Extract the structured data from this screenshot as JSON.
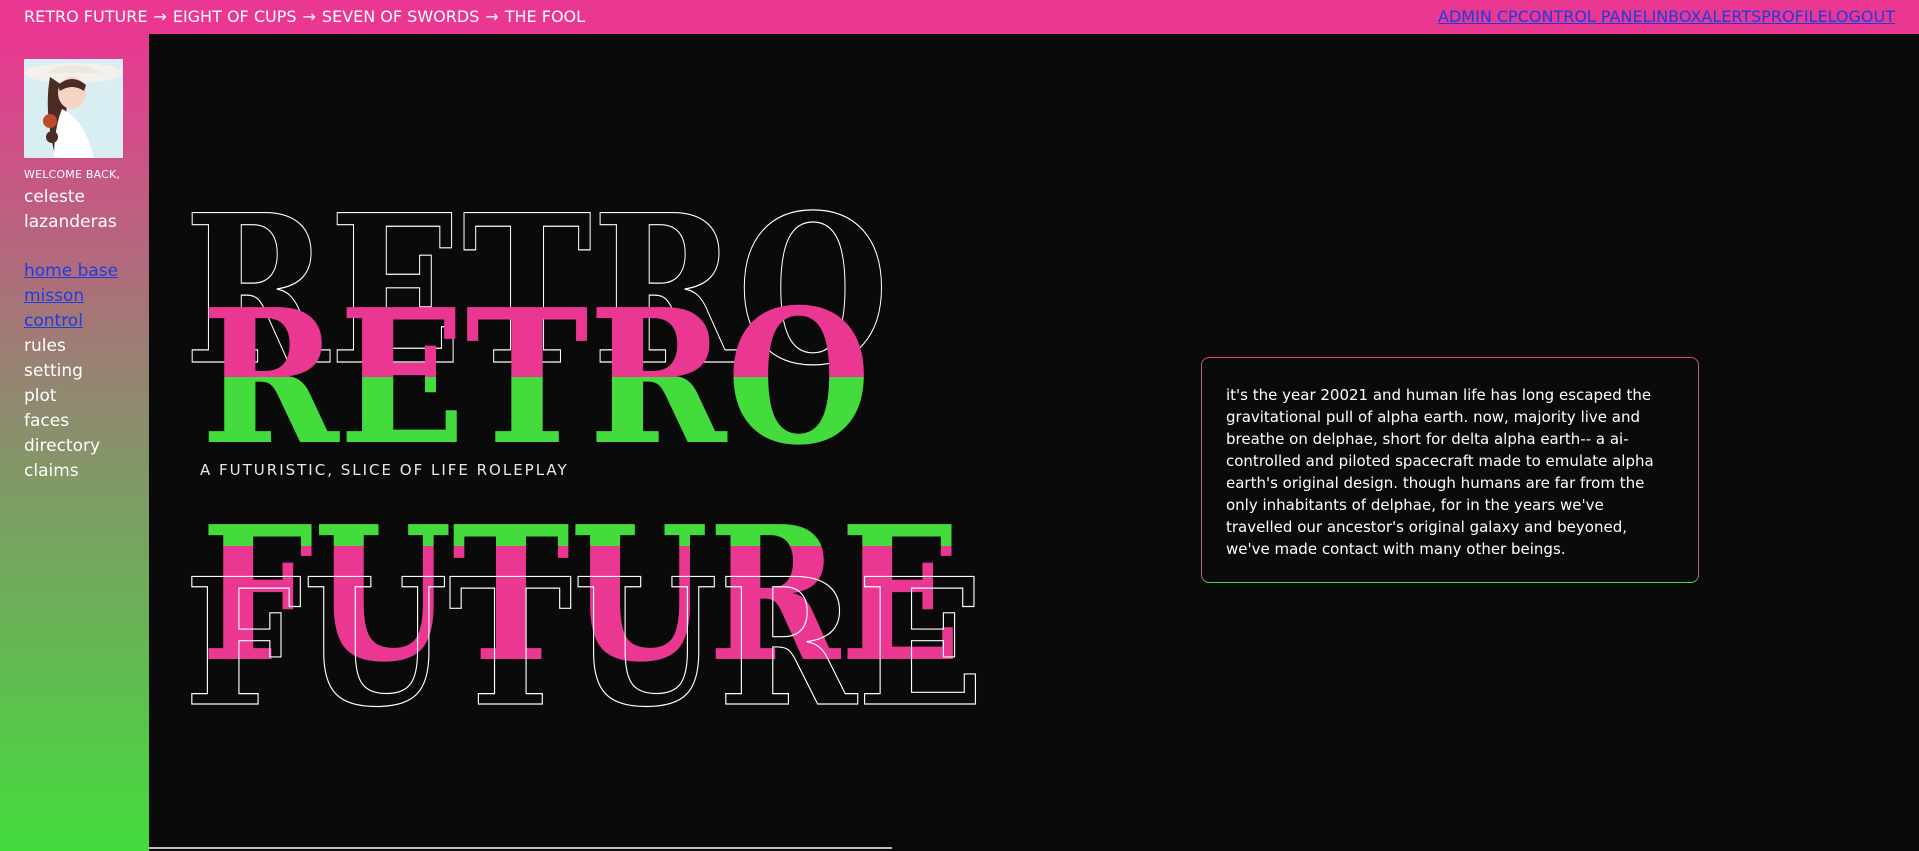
{
  "breadcrumb": {
    "items": [
      "RETRO FUTURE",
      "EIGHT OF CUPS",
      "SEVEN OF SWORDS",
      "THE FOOL"
    ],
    "separator": "→"
  },
  "topnav": {
    "links": [
      "ADMIN CP",
      "CONTROL PANEL",
      "INBOX",
      "ALERTS",
      "PROFILE",
      "LOGOUT"
    ]
  },
  "sidebar": {
    "welcome": "WELCOME BACK,",
    "username": "celeste lazanderas",
    "nav": [
      {
        "label": "home base",
        "link": true
      },
      {
        "label": "misson",
        "link": true
      },
      {
        "label": "control",
        "link": true
      },
      {
        "label": "rules",
        "link": false
      },
      {
        "label": "setting",
        "link": false
      },
      {
        "label": "plot",
        "link": false
      },
      {
        "label": "faces",
        "link": false
      },
      {
        "label": "directory",
        "link": false
      },
      {
        "label": "claims",
        "link": false
      }
    ]
  },
  "hero": {
    "word1": "RETRO",
    "word2": "FUTURE",
    "tagline": "A FUTURISTIC, SLICE OF LIFE ROLEPLAY"
  },
  "info": {
    "text": "it's the year 20021 and human life has long escaped the gravitational pull of alpha earth. now, majority live and breathe on delphae, short for delta alpha earth-- a ai-controlled and piloted spacecraft made to emulate alpha earth's original design. though humans are far from the only inhabitants of delphae, for in the years we've travelled our ancestor's original galaxy and beyoned, we've made contact with many other beings."
  },
  "colors": {
    "pink": "#ea3792",
    "green": "#43dc3c",
    "background": "#0a0a0a",
    "link": "#1d3de0"
  }
}
